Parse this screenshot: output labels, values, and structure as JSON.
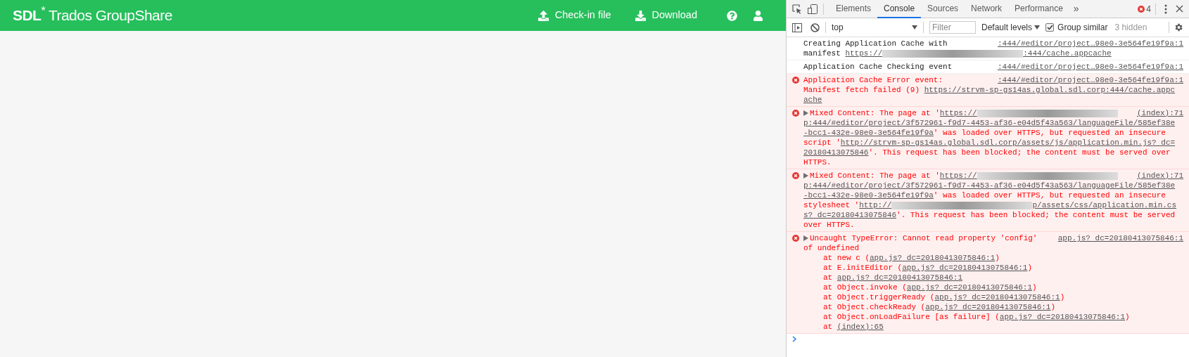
{
  "app_header": {
    "logo": "**SDL**$^{*}$ Trados GroupShare",
    "actions": [
      {
        "kind": "upload",
        "label": "Check-in file"
      },
      {
        "kind": "download",
        "label": "Download"
      }
    ],
    "icons": [
      {
        "kind": "help"
      },
      {
        "kind": "user"
      }
    ]
  },
  "devtools": {
    "tabs": [
      {
        "label": "Elements",
        "selected": false
      },
      {
        "label": "Console",
        "selected": true
      },
      {
        "label": "Sources",
        "selected": false
      },
      {
        "label": "Network",
        "selected": false
      },
      {
        "label": "Performance",
        "selected": false
      }
    ],
    "more_tabs": "»",
    "error_count": "4",
    "toolbar": {
      "context": "top",
      "filter_placeholder": "Filter",
      "levels": "Default levels",
      "group_similar": {
        "label": "Group similar",
        "checked": true
      },
      "hidden_count": "3 hidden"
    },
    "messages": [
      {
        "kind": "info",
        "expandable": false,
        "source": ":444/#editor/project…98e0-3e564fe19f9a:1",
        "lines": [
          [
            {
              "kind": "text",
              "s": "Creating Application Cache with"
            }
          ],
          [
            {
              "kind": "text",
              "s": "manifest "
            },
            {
              "kind": "link",
              "s": "https://"
            },
            {
              "kind": "redacted"
            },
            {
              "kind": "link",
              "s": ":444/cache.appcache"
            }
          ]
        ]
      },
      {
        "kind": "info",
        "expandable": false,
        "source": ":444/#editor/project…98e0-3e564fe19f9a:1",
        "lines": [
          [
            {
              "kind": "text",
              "s": "Application Cache Checking event"
            }
          ]
        ]
      },
      {
        "kind": "error",
        "expandable": false,
        "source": ":444/#editor/project…98e0-3e564fe19f9a:1",
        "lines": [
          [
            {
              "kind": "text",
              "s": "Application Cache Error event:"
            }
          ],
          [
            {
              "kind": "text",
              "s": "Manifest fetch failed (9) "
            },
            {
              "kind": "link",
              "s": "https://strvm-sp-gs14as.global.sdl.corp:444/cache.appc"
            }
          ],
          [
            {
              "kind": "link",
              "s": "ache"
            }
          ]
        ]
      },
      {
        "kind": "error",
        "expandable": true,
        "source": "(index):71",
        "lines": [
          [
            {
              "kind": "text",
              "s": "Mixed Content: The page at '"
            },
            {
              "kind": "link",
              "s": "https://"
            },
            {
              "kind": "redacted"
            }
          ],
          [
            {
              "kind": "link",
              "s": "p:444/#editor/project/3f572961-f9d7-4453-af36-e04d5f43a563/languageFile/585ef38e"
            }
          ],
          [
            {
              "kind": "link",
              "s": "-bcc1-432e-98e0-3e564fe19f9a"
            },
            {
              "kind": "text",
              "s": "' was loaded over HTTPS, but requested an insecure"
            }
          ],
          [
            {
              "kind": "text",
              "s": "script '"
            },
            {
              "kind": "link",
              "s": "http://strvm-sp-gs14as.global.sdl.corp/assets/js/application.min.js? dc="
            }
          ],
          [
            {
              "kind": "link",
              "s": "20180413075846"
            },
            {
              "kind": "text",
              "s": "'. This request has been blocked; the content must be served over"
            }
          ],
          [
            {
              "kind": "text",
              "s": "HTTPS."
            }
          ]
        ]
      },
      {
        "kind": "error",
        "expandable": true,
        "source": "(index):71",
        "lines": [
          [
            {
              "kind": "text",
              "s": "Mixed Content: The page at '"
            },
            {
              "kind": "link",
              "s": "https://"
            },
            {
              "kind": "redacted"
            }
          ],
          [
            {
              "kind": "link",
              "s": "p:444/#editor/project/3f572961-f9d7-4453-af36-e04d5f43a563/languageFile/585ef38e"
            }
          ],
          [
            {
              "kind": "link",
              "s": "-bcc1-432e-98e0-3e564fe19f9a"
            },
            {
              "kind": "text",
              "s": "' was loaded over HTTPS, but requested an insecure"
            }
          ],
          [
            {
              "kind": "text",
              "s": "stylesheet '"
            },
            {
              "kind": "link",
              "s": "http://"
            },
            {
              "kind": "redacted"
            },
            {
              "kind": "link",
              "s": "p/assets/css/application.min.cs"
            }
          ],
          [
            {
              "kind": "link",
              "s": "s? dc=20180413075846"
            },
            {
              "kind": "text",
              "s": "'. This request has been blocked; the content must be served"
            }
          ],
          [
            {
              "kind": "text",
              "s": "over HTTPS."
            }
          ]
        ]
      },
      {
        "kind": "error",
        "expandable": true,
        "source": "app.js? dc=20180413075846:1",
        "lines": [
          [
            {
              "kind": "text",
              "s": "Uncaught TypeError: Cannot read property 'config'"
            }
          ],
          [
            {
              "kind": "text",
              "s": "of undefined"
            }
          ]
        ],
        "stack": [
          {
            "before": "at new c (",
            "link": "app.js? dc=20180413075846:1",
            "after": ")"
          },
          {
            "before": "at E.initEditor (",
            "link": "app.js? dc=20180413075846:1",
            "after": ")"
          },
          {
            "before": "at ",
            "link": "app.js? dc=20180413075846:1"
          },
          {
            "before": "at Object.invoke (",
            "link": "app.js? dc=20180413075846:1",
            "after": ")"
          },
          {
            "before": "at Object.triggerReady (",
            "link": "app.js? dc=20180413075846:1",
            "after": ")"
          },
          {
            "before": "at Object.checkReady (",
            "link": "app.js? dc=20180413075846:1",
            "after": ")"
          },
          {
            "before": "at Object.onLoadFailure [as failure] (",
            "link": "app.js? dc=20180413075846:1",
            "after": ")"
          },
          {
            "before": "at ",
            "link": "(index):65"
          }
        ]
      }
    ]
  }
}
